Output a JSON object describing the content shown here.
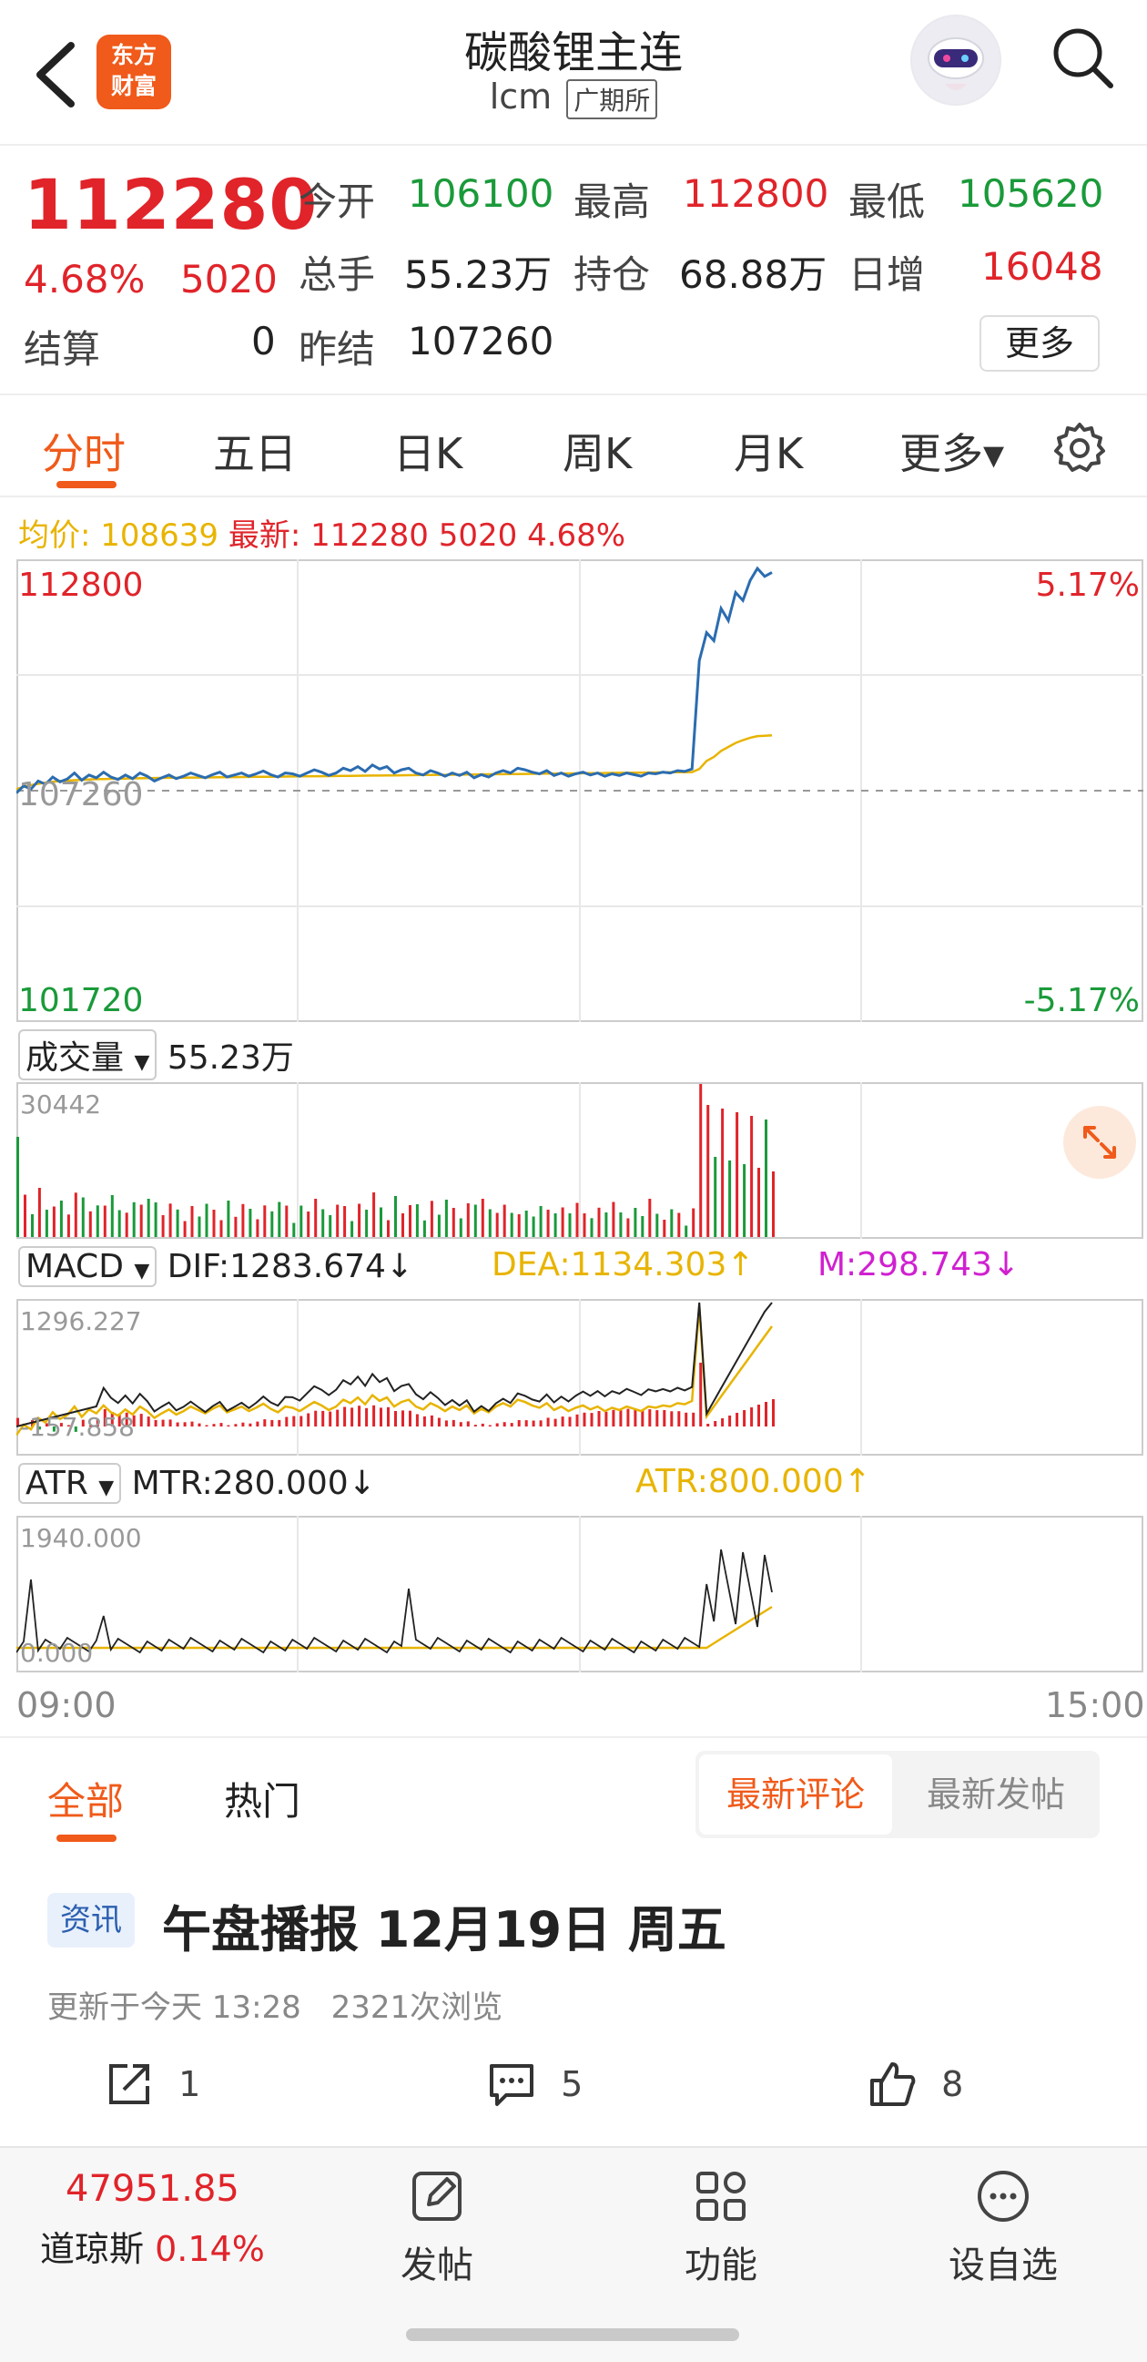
{
  "header": {
    "logo_line1": "东方",
    "logo_line2": "财富",
    "title": "碳酸锂主连",
    "code": "lcm",
    "exchange": "广期所"
  },
  "quote": {
    "price": "112280",
    "change_pct": "4.68%",
    "change": "5020",
    "settle_label": "结算",
    "settle": "0",
    "open_label": "今开",
    "open": "106100",
    "high_label": "最高",
    "high": "112800",
    "low_label": "最低",
    "low": "105620",
    "volume_label": "总手",
    "volume": "55.23万",
    "oi_label": "持仓",
    "oi": "68.88万",
    "daily_inc_label": "日增",
    "daily_inc": "16048",
    "prev_settle_label": "昨结",
    "prev_settle": "107260",
    "more_button": "更多"
  },
  "tabs": [
    "分时",
    "五日",
    "日K",
    "周K",
    "月K",
    "更多▾"
  ],
  "chart_info": {
    "avg_label": "均价: 108639",
    "latest_label": "最新: 112280 5020 4.68%"
  },
  "chart_data": {
    "type": "line",
    "title": "",
    "x_start_label": "09:00",
    "x_end_label": "15:00",
    "ylim": [
      101720,
      112800
    ],
    "y_top_label": "112800",
    "y_bottom_label": "101720",
    "y_mid_label": "107260",
    "pct_top_label": "5.17%",
    "pct_bottom_label": "-5.17%",
    "series": [
      {
        "name": "price",
        "color": "#2b6cb0",
        "values": [
          107200,
          107380,
          107300,
          107500,
          107420,
          107600,
          107480,
          107550,
          107700,
          107520,
          107650,
          107580,
          107720,
          107600,
          107540,
          107650,
          107560,
          107700,
          107620,
          107500,
          107580,
          107650,
          107560,
          107620,
          107700,
          107640,
          107580,
          107660,
          107720,
          107600,
          107650,
          107700,
          107620,
          107680,
          107750,
          107660,
          107600,
          107700,
          107680,
          107620,
          107700,
          107780,
          107720,
          107640,
          107700,
          107820,
          107760,
          107860,
          107740,
          107900,
          107800,
          107860,
          107700,
          107780,
          107820,
          107700,
          107650,
          107760,
          107700,
          107620,
          107700,
          107640,
          107720,
          107580,
          107660,
          107600,
          107700,
          107760,
          107700,
          107820,
          107780,
          107720,
          107680,
          107760,
          107640,
          107700,
          107620,
          107680,
          107720,
          107650,
          107700,
          107620,
          107680,
          107640,
          107700,
          107660,
          107620,
          107700,
          107680,
          107720,
          107700,
          107760,
          107740,
          107800,
          110500,
          111200,
          111000,
          111800,
          111500,
          112200,
          112000,
          112500,
          112800,
          112600,
          112700
        ]
      },
      {
        "name": "avg",
        "color": "#e8b400",
        "values": [
          107300,
          107350,
          107400,
          107430,
          107460,
          107480,
          107500,
          107510,
          107520,
          107530,
          107540,
          107545,
          107550,
          107555,
          107560,
          107563,
          107566,
          107569,
          107572,
          107575,
          107578,
          107580,
          107582,
          107584,
          107586,
          107588,
          107590,
          107592,
          107594,
          107596,
          107598,
          107600,
          107602,
          107604,
          107606,
          107608,
          107610,
          107612,
          107614,
          107616,
          107618,
          107620,
          107622,
          107624,
          107626,
          107628,
          107630,
          107632,
          107634,
          107636,
          107638,
          107640,
          107642,
          107644,
          107646,
          107648,
          107650,
          107652,
          107654,
          107656,
          107658,
          107660,
          107662,
          107664,
          107666,
          107668,
          107670,
          107672,
          107674,
          107676,
          107678,
          107680,
          107682,
          107684,
          107686,
          107688,
          107690,
          107692,
          107694,
          107696,
          107698,
          107700,
          107702,
          107704,
          107706,
          107708,
          107710,
          107712,
          107714,
          107716,
          107718,
          107720,
          107722,
          107724,
          107800,
          108000,
          108100,
          108250,
          108350,
          108450,
          108520,
          108580,
          108620,
          108630,
          108639
        ]
      }
    ]
  },
  "volume_panel": {
    "selector": "成交量",
    "value": "55.23万",
    "max_label": "30442"
  },
  "macd_panel": {
    "selector": "MACD",
    "dif": "DIF:1283.674↓",
    "dea": "DEA:1134.303↑",
    "m": "M:298.743↓",
    "top_label": "1296.227",
    "bottom_label": "-157.858"
  },
  "atr_panel": {
    "selector": "ATR",
    "mtr": "MTR:280.000↓",
    "atr": "ATR:800.000↑",
    "top_label": "1940.000",
    "bottom_label": "0.000"
  },
  "comments": {
    "tab_all": "全部",
    "tab_hot": "热门",
    "sort_latest_comment": "最新评论",
    "sort_latest_post": "最新发帖",
    "post": {
      "badge": "资讯",
      "title": "午盘播报 12月19日 周五",
      "meta_time": "更新于今天 13:28",
      "meta_views": "2321次浏览",
      "share_count": "1",
      "comment_count": "5",
      "like_count": "8"
    }
  },
  "bottom_bar": {
    "index_value": "47951.85",
    "index_name": "道琼斯",
    "index_change": "0.14%",
    "post_label": "发帖",
    "function_label": "功能",
    "watchlist_label": "设自选"
  },
  "colors": {
    "accent": "#f05a1a",
    "up": "#e0242a",
    "down": "#1a9a3a",
    "price_line": "#2b6cb0",
    "avg_line": "#e8b400"
  }
}
